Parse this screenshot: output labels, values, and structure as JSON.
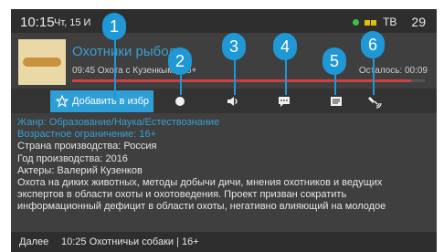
{
  "topbar": {
    "time": "10:15",
    "date": "Чт, 15 И",
    "source": "ТВ",
    "channel_number": "29"
  },
  "program": {
    "title": "Охотники рыбол",
    "time_info": "09:45  Охота с Кузенк",
    "time_info_tail": "ым | 16+",
    "remaining": "Осталось: 00:09",
    "progress": 0.96
  },
  "actions": {
    "favorite_label": "Добавить в избр"
  },
  "callouts": [
    "1",
    "2",
    "3",
    "4",
    "5",
    "6"
  ],
  "details": {
    "genre": "Жанр: Образование/Наука/Естествознание",
    "age": "Возрастное ограничение: 16+",
    "country": "Страна производства: Россия",
    "year": "Год производства: 2016",
    "actors": "Актеры: Валерий Кузенков",
    "description": "Охота на диких животных, методы добычи дичи, мнения охотников и ведущих экспертов в области охоты и охотоведения. Проект призван сократить информационный дефицит в области охоты, негативно влияющий на молодое"
  },
  "footer": {
    "label": "Далее",
    "next": "10:25  Охотничьи собаки | 16+"
  },
  "colors": {
    "accent": "#1f98d5",
    "progress": "#d04040",
    "link": "#3aa0d0"
  }
}
